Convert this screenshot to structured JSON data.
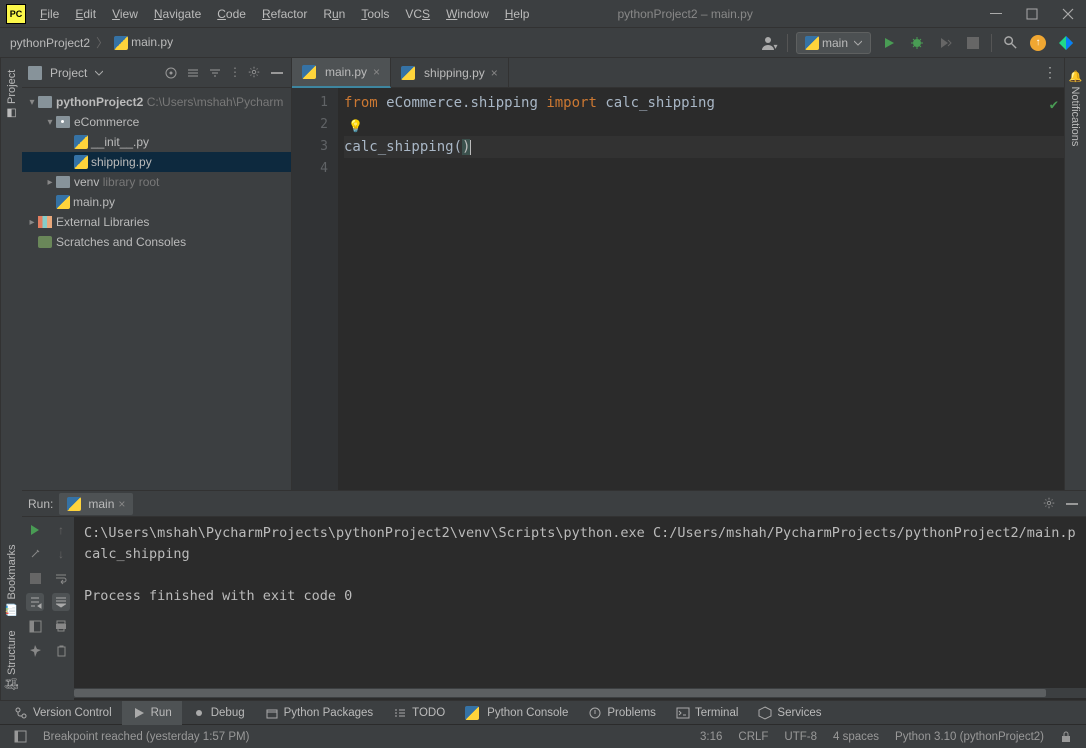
{
  "window": {
    "title": "pythonProject2 – main.py"
  },
  "menu": [
    "File",
    "Edit",
    "View",
    "Navigate",
    "Code",
    "Refactor",
    "Run",
    "Tools",
    "VCS",
    "Window",
    "Help"
  ],
  "breadcrumbs": {
    "root": "pythonProject2",
    "file": "main.py"
  },
  "run_config": {
    "name": "main"
  },
  "side_tabs": {
    "project": "Project",
    "bookmarks": "Bookmarks",
    "structure": "Structure",
    "notifications": "Notifications"
  },
  "project_panel": {
    "title": "Project",
    "tree": {
      "root": "pythonProject2",
      "root_path": "C:\\Users\\mshah\\Pycharm",
      "pkg": "eCommerce",
      "init": "__init__.py",
      "shipping": "shipping.py",
      "venv": "venv",
      "venv_hint": "library root",
      "main": "main.py",
      "ext": "External Libraries",
      "scratch": "Scratches and Consoles"
    }
  },
  "editor_tabs": [
    {
      "label": "main.py",
      "active": true
    },
    {
      "label": "shipping.py",
      "active": false
    }
  ],
  "code": {
    "lines": [
      "1",
      "2",
      "3",
      "4"
    ],
    "l1_from": "from",
    "l1_mod": "eCommerce.shipping",
    "l1_import": "import",
    "l1_name": "calc_shipping",
    "l3_fn": "calc_shipping",
    "l3_paren": "()"
  },
  "cursor": {
    "line": 3,
    "col": 16
  },
  "run_panel": {
    "label": "Run:",
    "tab": "main",
    "out_line1": "C:\\Users\\mshah\\PycharmProjects\\pythonProject2\\venv\\Scripts\\python.exe C:/Users/mshah/PycharmProjects/pythonProject2/main.p",
    "out_line2": "calc_shipping",
    "out_line3": "",
    "out_line4": "Process finished with exit code 0"
  },
  "bottom_tools": {
    "vcs": "Version Control",
    "run": "Run",
    "debug": "Debug",
    "pypkg": "Python Packages",
    "todo": "TODO",
    "pyconsole": "Python Console",
    "problems": "Problems",
    "terminal": "Terminal",
    "services": "Services"
  },
  "status": {
    "msg": "Breakpoint reached (yesterday 1:57 PM)",
    "pos": "3:16",
    "eol": "CRLF",
    "enc": "UTF-8",
    "indent": "4 spaces",
    "interp": "Python 3.10 (pythonProject2)"
  }
}
